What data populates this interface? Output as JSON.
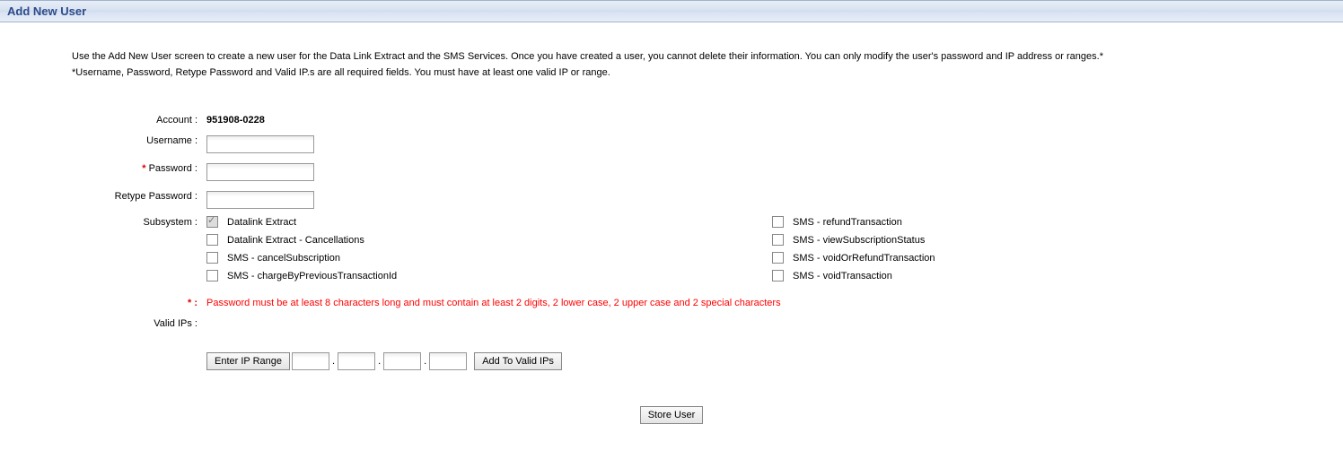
{
  "title": "Add New User",
  "intro_line1": "Use the Add New User screen to create a new user for the Data Link Extract and the SMS Services. Once you have created a user, you cannot delete their information. You can only modify the user's password and IP address or ranges.*",
  "intro_line2": "*Username, Password, Retype Password and Valid IP.s are all required fields. You must have at least one valid IP or range.",
  "labels": {
    "account": "Account :",
    "username": "Username :",
    "password": "Password :",
    "retype": "Retype Password :",
    "subsystem": "Subsystem :",
    "note_marker": "* :",
    "valid_ips": "Valid IPs :"
  },
  "required_marker": "*",
  "account_value": "951908-0228",
  "subsystems_left": [
    {
      "label": "Datalink Extract",
      "checked": true
    },
    {
      "label": "Datalink Extract - Cancellations",
      "checked": false
    },
    {
      "label": "SMS - cancelSubscription",
      "checked": false
    },
    {
      "label": "SMS - chargeByPreviousTransactionId",
      "checked": false
    }
  ],
  "subsystems_right": [
    {
      "label": "SMS - refundTransaction",
      "checked": false
    },
    {
      "label": "SMS - viewSubscriptionStatus",
      "checked": false
    },
    {
      "label": "SMS - voidOrRefundTransaction",
      "checked": false
    },
    {
      "label": "SMS - voidTransaction",
      "checked": false
    }
  ],
  "password_note": "Password must be at least 8 characters long and must contain at least 2 digits, 2 lower case, 2 upper case and 2 special characters",
  "buttons": {
    "enter_ip": "Enter IP Range",
    "add_ip": "Add To Valid IPs",
    "store": "Store User"
  },
  "dot": "."
}
